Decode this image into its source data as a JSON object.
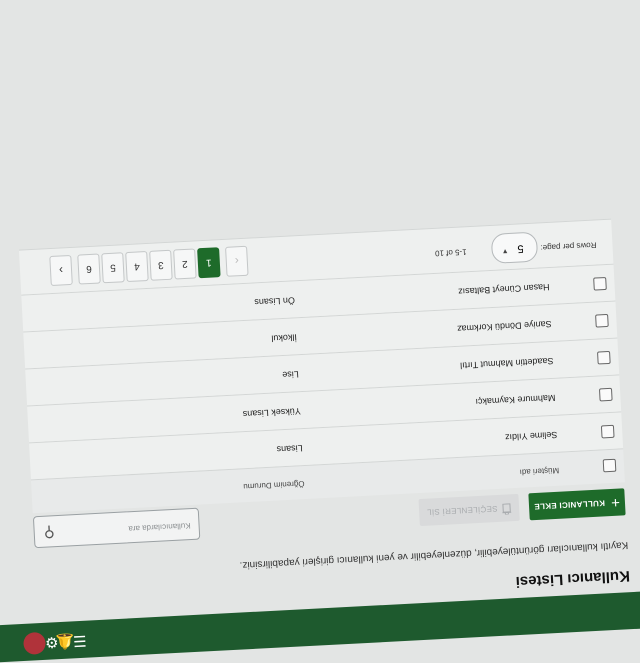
{
  "page": {
    "title": "Kullanıcı Listesi",
    "subtitle": "Kayıtlı kullanıcıları görüntüleyebilir, düzenleyebilir ve yeni kullanıcı girişleri yapabilirsiniz."
  },
  "toolbar": {
    "add_label": "KULLANICI EKLE",
    "delete_label": "SEÇİLENLERİ SİL",
    "search_placeholder": "Kullanıcılarda ara"
  },
  "table": {
    "headers": {
      "name": "Müşteri adı",
      "education": "Öğrenim Durumu"
    },
    "rows": [
      {
        "name": "Selime Yıldız",
        "education": "Lisans"
      },
      {
        "name": "Mahmure Kaymakçı",
        "education": "Yüksek Lisans"
      },
      {
        "name": "Saadettin Mahmut Tırtıl",
        "education": "Lise"
      },
      {
        "name": "Saniye Döndü Korkmaz",
        "education": "İlkokul"
      },
      {
        "name": "Hasan Cüneyt Baltasız",
        "education": "Ön Lisans"
      }
    ]
  },
  "pagination": {
    "rows_per_page_label": "Rows per page:",
    "rows_per_page_value": "5",
    "range_label": "1-5 of 10",
    "pages": [
      "1",
      "2",
      "3",
      "4",
      "5",
      "6"
    ],
    "active_page": "1",
    "prev_glyph": "‹",
    "next_glyph": "›"
  },
  "icons": {
    "add": "plus-icon",
    "delete": "trash-icon",
    "search": "search-icon",
    "dropdown": "caret-down-icon"
  },
  "colors": {
    "primary": "#1e6b2a",
    "topbar": "#1e5a2e",
    "background": "#e3e5e4"
  }
}
